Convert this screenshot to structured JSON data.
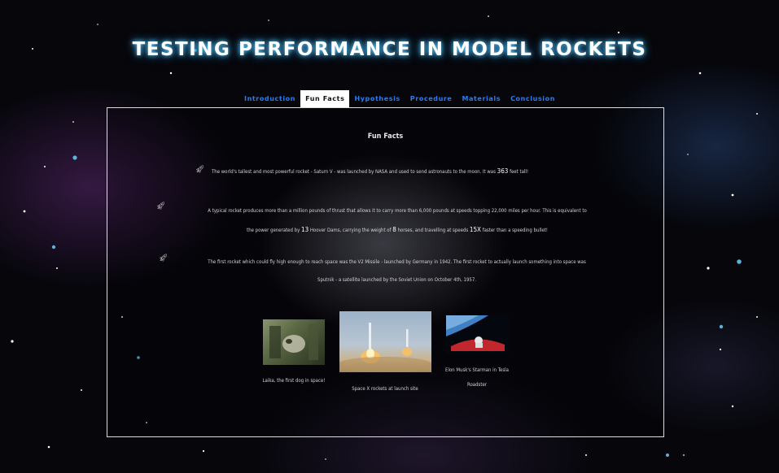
{
  "title": "TESTING PERFORMANCE IN MODEL ROCKETS",
  "tabs": [
    "Introduction",
    "Fun Facts",
    "Hypothesis",
    "Procedure",
    "Materials",
    "Conclusion"
  ],
  "active_tab": "Fun Facts",
  "panel": {
    "heading": "Fun Facts",
    "fact1": {
      "a": "The world's tallest and most powerful rocket - Saturn V - was launched by NASA and used to send astronauts to the moon. It was ",
      "n1": "363",
      "b": " feet tall!"
    },
    "fact2": {
      "line1": "A typical rocket produces more than a million pounds of thrust that allows it to carry more than 6,000 pounds at speeds topping 22,000 miles per hour. This is equivalent to",
      "a": "the power generated by ",
      "n1": "13",
      "b": " Hoover Dams, carrying the weight of ",
      "n2": "8",
      "c": " horses, and travelling at speeds ",
      "n3": "15X",
      "d": " faster than a speeding bullet!"
    },
    "fact3": {
      "line1": "The first rocket which could fly high enough to reach space was the V2 Missile - launched by Germany in 1942. The first rocket to actually launch something into space was",
      "line2": "Sputnik - a satellite launched by the Soviet Union on October 4th, 1957."
    },
    "images": [
      {
        "caption": "Laika, the first dog in space!"
      },
      {
        "caption": "Space X rockets at launch site"
      },
      {
        "caption_l1": "Elon Musk's Starman in Tesla",
        "caption_l2": "Roadster"
      }
    ]
  },
  "icons": {
    "fact_bullet": "rocket-icon"
  }
}
